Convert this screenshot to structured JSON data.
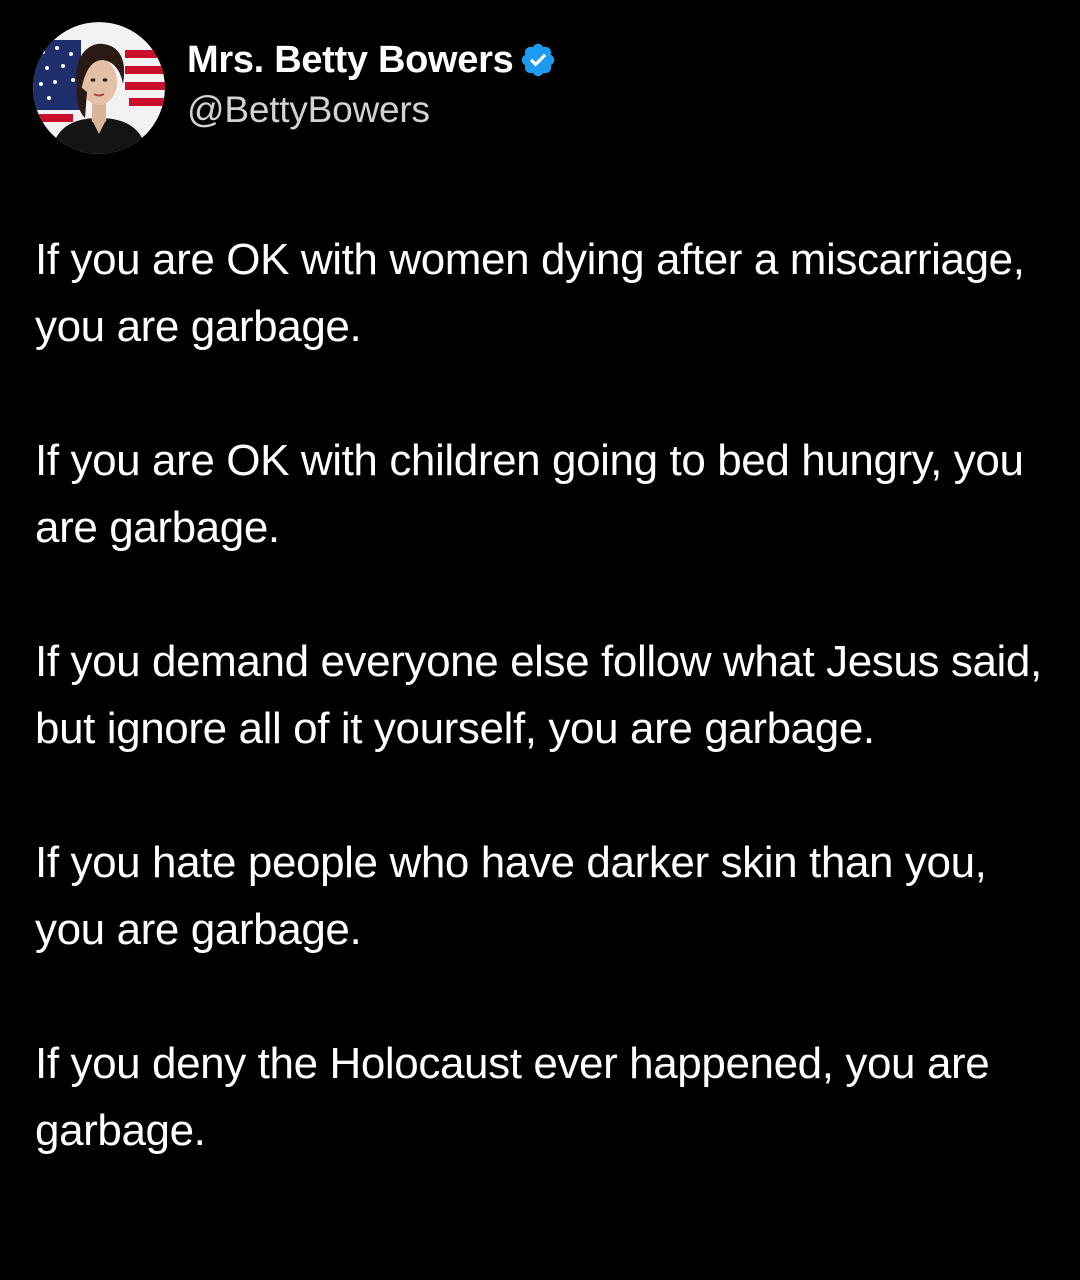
{
  "tweet": {
    "author": {
      "display_name": "Mrs. Betty Bowers",
      "handle": "@BettyBowers",
      "verified": true,
      "verified_color": "#1d9bf0"
    },
    "paragraphs": [
      "If you are OK with women dying after a miscarriage, you are garbage.",
      "If you are OK with children going to bed hungry, you are garbage.",
      "If you demand everyone else follow what Jesus said, but ignore all of it yourself, you are garbage.",
      "If you hate people who have darker skin than you, you are garbage.",
      "If you deny the Holocaust ever happened, you are garbage."
    ]
  },
  "theme": {
    "background": "#000000",
    "text": "#ffffff",
    "secondary_text": "#cfd3d6"
  }
}
